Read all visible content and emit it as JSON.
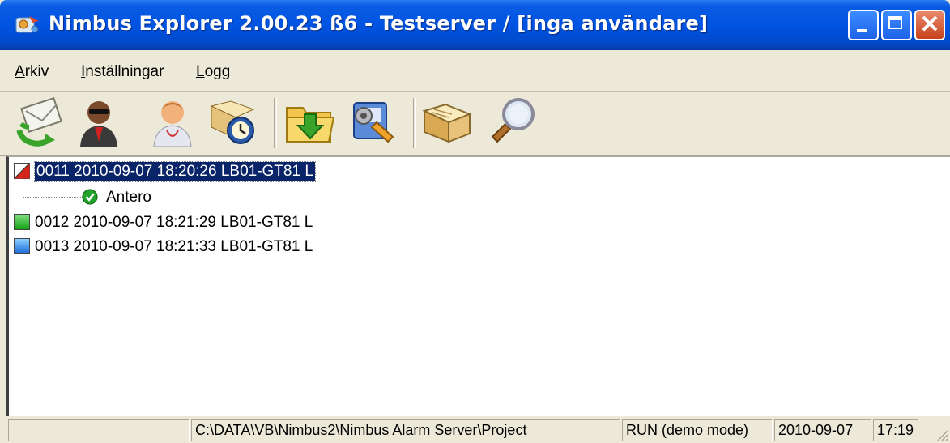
{
  "window": {
    "title": "Nimbus Explorer 2.00.23 ß6 - Testserver / [inga användare]",
    "app_icon": "nimbus-app-icon",
    "controls": [
      "minimize-icon",
      "maximize-icon",
      "close-icon"
    ]
  },
  "menu": {
    "items": [
      {
        "accel": "A",
        "rest": "rkiv"
      },
      {
        "accel": "I",
        "rest": "nställningar"
      },
      {
        "accel": "L",
        "rest": "ogg"
      }
    ]
  },
  "toolbar": {
    "buttons": [
      "mail-refresh-icon",
      "user-dark-icon",
      "user-doctor-icon",
      "book-clock-icon",
      "folder-download-icon",
      "settings-tools-icon",
      "book-icon",
      "search-icon"
    ]
  },
  "tree": {
    "rows": [
      {
        "id": "0011",
        "text": "0011 2010-09-07 18:20:26 LB01-GT81 L",
        "status_icon": "red-white-square",
        "selected": true,
        "children": [
          {
            "text": "Antero",
            "icon": "green-check-icon"
          }
        ]
      },
      {
        "id": "0012",
        "text": "0012 2010-09-07 18:21:29 LB01-GT81 L",
        "status_icon": "green-square"
      },
      {
        "id": "0013",
        "text": "0013 2010-09-07 18:21:33 LB01-GT81 L",
        "status_icon": "blue-square"
      }
    ]
  },
  "status": {
    "empty": "",
    "path": "C:\\DATA\\VB\\Nimbus2\\Nimbus Alarm Server\\Project",
    "mode": "RUN (demo mode)",
    "date": "2010-09-07",
    "time": "17:19"
  },
  "colors": {
    "titlebar": "#0054e3",
    "selection": "#0a246a",
    "window_face": "#ece9d8",
    "close_button": "#c7411c"
  }
}
